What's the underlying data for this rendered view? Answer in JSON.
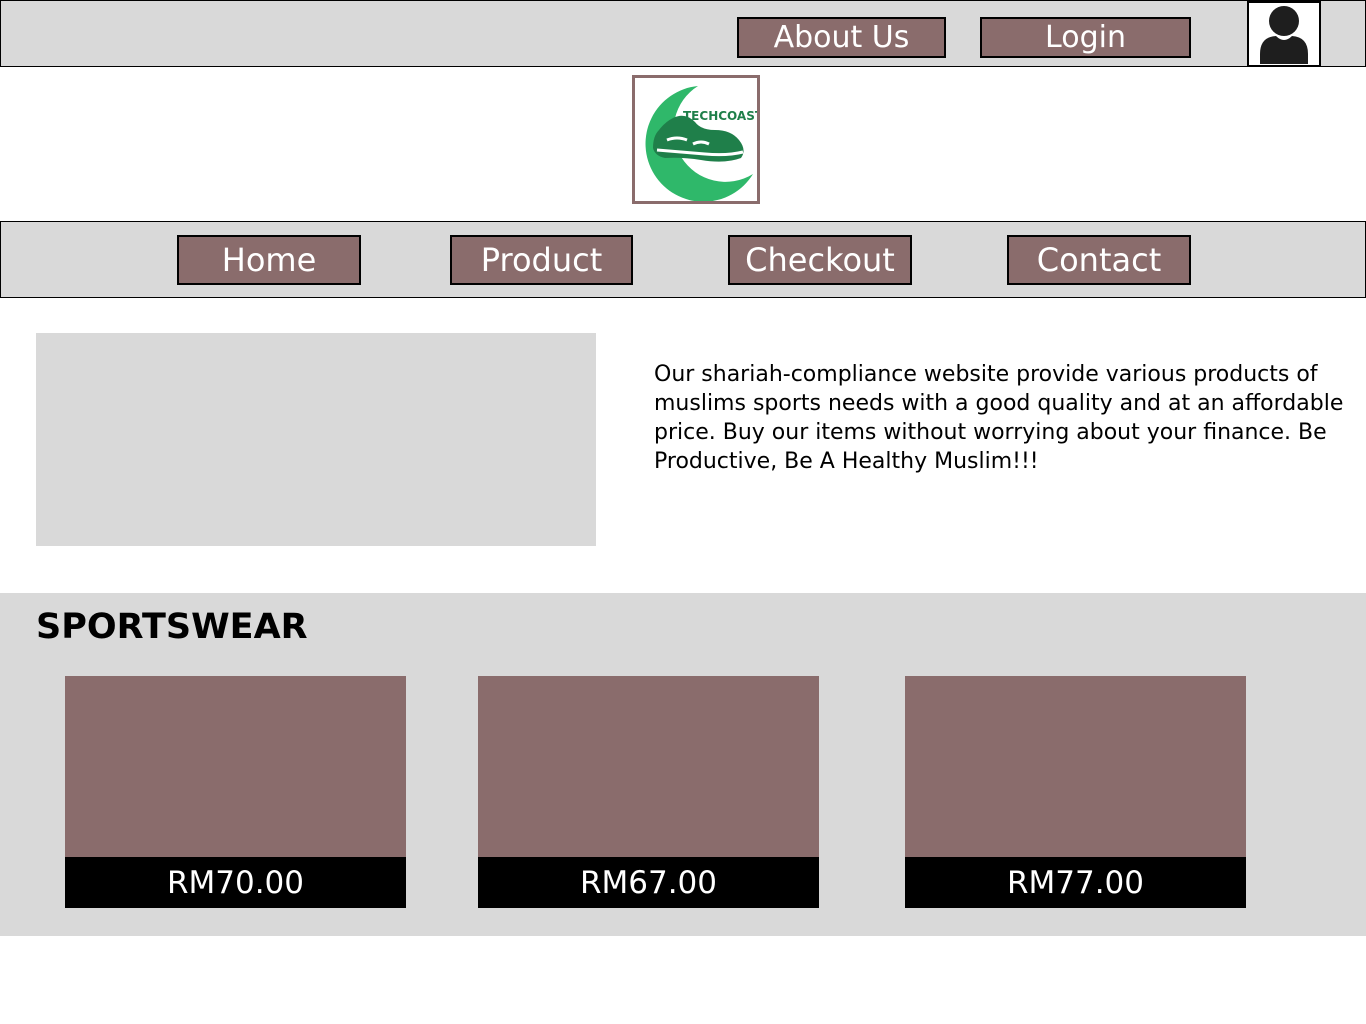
{
  "header": {
    "about_label": "About Us",
    "login_label": "Login",
    "account_icon": "user-avatar-icon"
  },
  "logo": {
    "text": "TECHCOAST",
    "icon": "crescent-shoe-logo"
  },
  "nav": {
    "items": [
      {
        "label": "Home"
      },
      {
        "label": "Product"
      },
      {
        "label": "Checkout"
      },
      {
        "label": "Contact"
      }
    ]
  },
  "hero": {
    "description": "Our shariah-compliance website provide various products of muslims sports needs with a good quality and at an affordable price. Buy our items without worrying  about your finance. Be Productive, Be A Healthy Muslim!!!"
  },
  "sportswear": {
    "title": "SPORTSWEAR",
    "products": [
      {
        "price": "RM70.00"
      },
      {
        "price": "RM67.00"
      },
      {
        "price": "RM77.00"
      }
    ]
  },
  "colors": {
    "button_bg": "#8a6c6c",
    "bar_bg": "#d9d9d9",
    "logo_green": "#2fb86a",
    "logo_dark_green": "#1f7f4a"
  }
}
